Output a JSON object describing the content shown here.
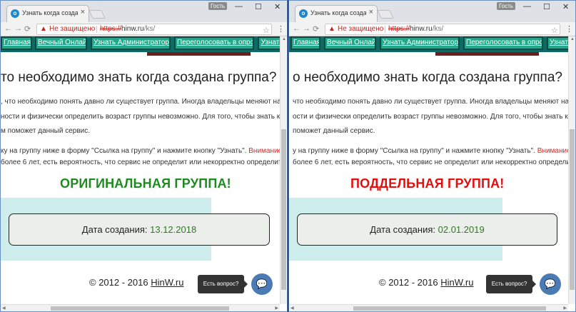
{
  "windows": [
    {
      "id": "left",
      "tab_title": "Узнать когда создана гр",
      "guest_label": "Гость",
      "url_warning": "Не защищено",
      "url_scheme": "https://",
      "url_host": "hinw.ru",
      "url_path": "/ks/",
      "nav": [
        "Главная",
        "Вечный Онлайн",
        "Узнать Администратора",
        "Переголосовать в опросе",
        "Узнать"
      ],
      "heading": "то необходимо знать когда создана группа?",
      "para1": [
        ",  что необходимо понять давно ли существует группа. Иногда владельцы меняют на",
        "ности и физически определить возраст группы невозможно. Для того, чтобы знать ко",
        "м поможет данный сервис."
      ],
      "para2_line1": "ку на группу ниже в форму \"Ссылка на группу\" и нажмите кнопку \"Узнать\". ",
      "para2_red": "Внимание",
      "para2_line2": "более 6 лет, есть вероятность, что сервис не определит или некорректно определит",
      "verdict": "ОРИГИНАЛЬНАЯ ГРУППА!",
      "verdict_color": "#1f8a1f",
      "date_label": "Дата создания:",
      "date_value": "13.12.2018",
      "footer_text": "© 2012 - 2016",
      "footer_link": "HinW.ru",
      "ask_label": "Есть вопрос?"
    },
    {
      "id": "right",
      "tab_title": "Узнать когда создана гр",
      "guest_label": "Гость",
      "url_warning": "Не защищено",
      "url_scheme": "https://",
      "url_host": "hinw.ru",
      "url_path": "/ks/",
      "nav": [
        "Главная",
        "Вечный Онлайн",
        "Узнать Администратора",
        "Переголосовать в опросе",
        "Узнать"
      ],
      "heading": "о необходимо знать когда создана группа?",
      "para1": [
        " что необходимо понять давно ли существует группа. Иногда владельцы меняют на",
        "ости и физически определить возраст группы невозможно. Для того, чтобы знать ко",
        " поможет данный сервис."
      ],
      "para2_line1": "у на группу ниже в форму \"Ссылка на группу\" и нажмите кнопку \"Узнать\". ",
      "para2_red": "Внимание",
      "para2_line2": "более 6 лет, есть вероятность, что сервис не определит или некорректно определит",
      "verdict": "ПОДДЕЛЬНАЯ ГРУППА!",
      "verdict_color": "#e01010",
      "date_label": "Дата создания:",
      "date_value": "02.01.2019",
      "footer_text": "© 2012 - 2016",
      "footer_link": "HinW.ru",
      "ask_label": "Есть вопрос?"
    }
  ]
}
